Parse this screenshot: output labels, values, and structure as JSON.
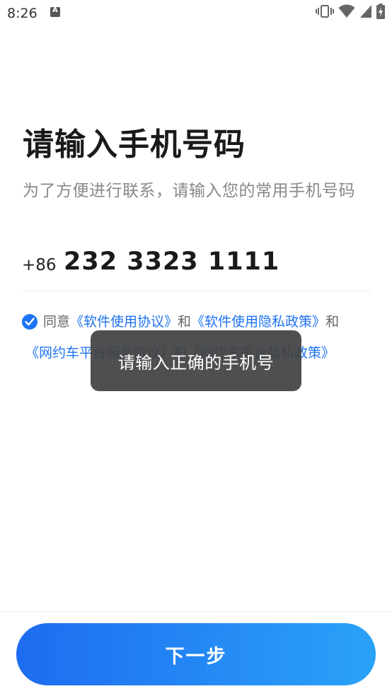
{
  "status_bar": {
    "time": "8:26",
    "icons": [
      "notification-a-icon",
      "vibrate-icon",
      "wifi-icon",
      "signal-icon",
      "battery-icon"
    ]
  },
  "page": {
    "title": "请输入手机号码",
    "subtitle": "为了方便进行联系，请输入您的常用手机号码"
  },
  "phone": {
    "country_code": "+86",
    "value": "232 3323 1111"
  },
  "agreement": {
    "checked": true,
    "prefix": "同意",
    "link_software_agreement": "《软件使用协议》",
    "and_1": "和",
    "link_software_privacy": "《软件使用隐私政策》",
    "and_2": "和",
    "link_platform_line2": "《网约车平台服务协议》和《网约车平台隐私政策》"
  },
  "toast": {
    "message": "请输入正确的手机号"
  },
  "footer": {
    "next_label": "下一步"
  },
  "colors": {
    "accent": "#1d72f3",
    "button_gradient_start": "#1e6cf0",
    "button_gradient_end": "#2aa2f8",
    "toast_bg": "#404040"
  }
}
